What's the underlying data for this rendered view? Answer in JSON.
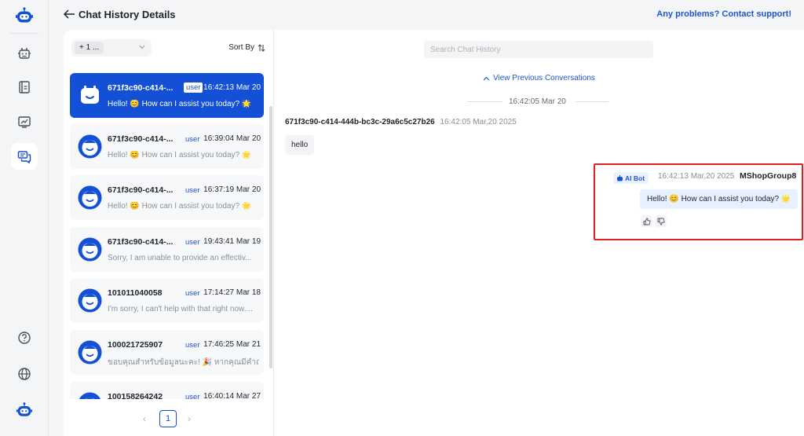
{
  "header": {
    "title": "Chat History Details",
    "support_link": "Any problems? Contact support!"
  },
  "rail": {
    "items": [
      {
        "icon": "robot-logo-icon"
      },
      {
        "icon": "bot-config-icon"
      },
      {
        "icon": "knowledge-book-icon"
      },
      {
        "icon": "analytics-chart-icon"
      },
      {
        "icon": "chat-history-icon",
        "active": true
      },
      {
        "icon": "help-circle-icon"
      },
      {
        "icon": "globe-icon"
      },
      {
        "icon": "robot-avatar-icon"
      }
    ]
  },
  "list": {
    "filter_value": "+ 1 ...",
    "sort_label": "Sort By",
    "conversations": [
      {
        "id": "671f3c90-c414-...",
        "role": "user",
        "time": "16:42:13 Mar 20",
        "preview": "Hello! 😊 How can I assist you today? 🌟",
        "active": true
      },
      {
        "id": "671f3c90-c414-...",
        "role": "user",
        "time": "16:39:04 Mar 20",
        "preview": "Hello! 😊 How can I assist you today? 🌟"
      },
      {
        "id": "671f3c90-c414-...",
        "role": "user",
        "time": "16:37:19 Mar 20",
        "preview": "Hello! 😊 How can I assist you today? 🌟"
      },
      {
        "id": "671f3c90-c414-...",
        "role": "user",
        "time": "19:43:41 Mar 19",
        "preview": "Sorry, I am unable to provide an effectiv..."
      },
      {
        "id": "101011040058",
        "role": "user",
        "time": "17:14:27 Mar 18",
        "preview": "I'm sorry, I can't help with that right now...."
      },
      {
        "id": "100021725907",
        "role": "user",
        "time": "17:46:25 Mar 21",
        "preview": "ขอบคุณสำหรับข้อมูลนะคะ! 🎉 หากคุณมีคำถ..."
      },
      {
        "id": "100158264242",
        "role": "user",
        "time": "16:40:14 Mar 27",
        "preview": ""
      }
    ],
    "page": "1"
  },
  "chat": {
    "search_placeholder": "Search Chat History",
    "view_previous": "View Previous Conversations",
    "date_divider": "16:42:05 Mar 20",
    "user_message": {
      "sender": "671f3c90-c414-444b-bc3c-29a6c5c27b26",
      "timestamp": "16:42:05 Mar,20 2025",
      "text": "hello"
    },
    "bot_message": {
      "tag": "AI Bot",
      "timestamp": "16:42:13 Mar,20 2025",
      "sender": "MShopGroup8",
      "text": "Hello! 😊 How can I assist you today? 🌟"
    }
  },
  "colors": {
    "accent": "#1450d6",
    "highlight": "#e02020"
  }
}
